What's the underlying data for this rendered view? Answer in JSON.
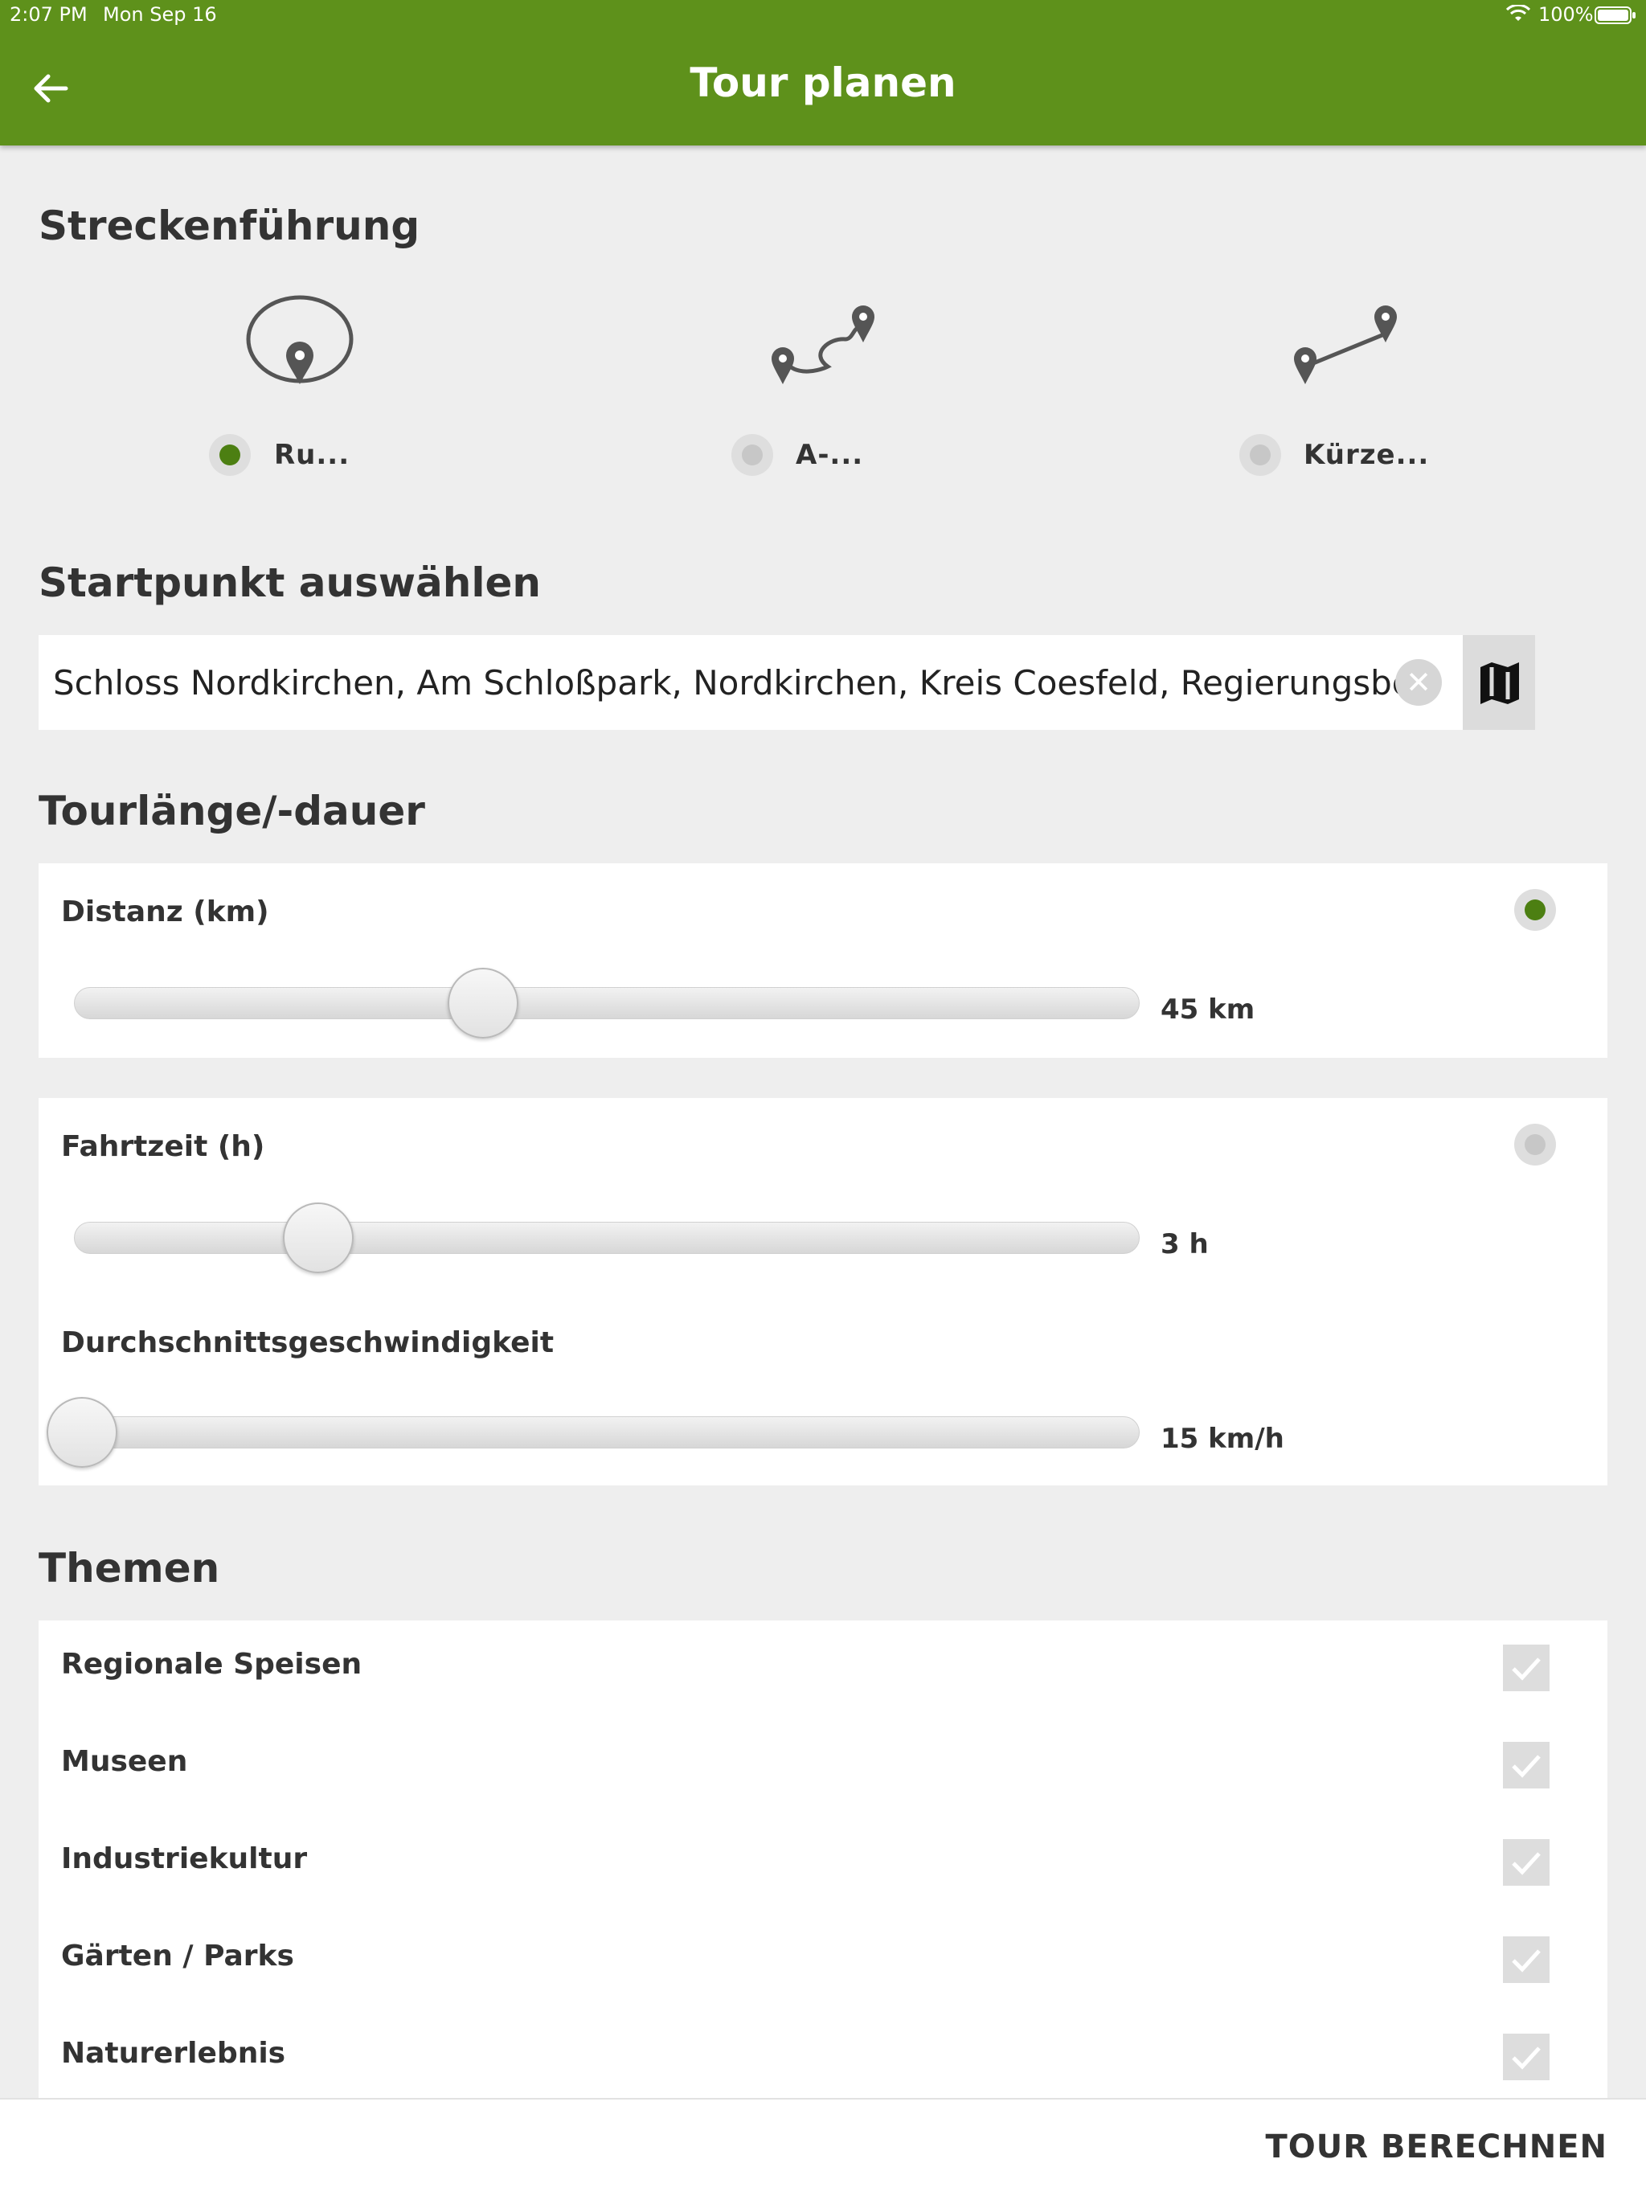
{
  "status_bar": {
    "time": "2:07 PM",
    "date": "Mon Sep 16",
    "battery": "100%"
  },
  "header": {
    "title": "Tour planen",
    "back_icon": "arrow-left-icon",
    "color": "#5e911b"
  },
  "route_section": {
    "title": "Streckenführung",
    "options": [
      {
        "label": "Ru...",
        "icon": "round-trip-icon",
        "selected": true
      },
      {
        "label": "A-...",
        "icon": "a-to-b-route-icon",
        "selected": false
      },
      {
        "label": "Kürze...",
        "icon": "shortest-route-icon",
        "selected": false
      }
    ]
  },
  "start_section": {
    "title": "Startpunkt auswählen",
    "value": "Schloss Nordkirchen, Am Schloßpark, Nordkirchen, Kreis Coesfeld, Regierungsbez",
    "clear_icon": "clear-icon",
    "map_icon": "map-icon"
  },
  "duration_section": {
    "title": "Tourlänge/-dauer",
    "distance": {
      "label": "Distanz (km)",
      "value_text": "45 km",
      "selected": true,
      "level": 0.39
    },
    "time": {
      "label": "Fahrtzeit (h)",
      "value_text": "3 h",
      "selected": false,
      "level": 0.23
    },
    "speed": {
      "label": "Durchschnittsgeschwindigkeit",
      "value_text": "15 km/h",
      "level": 0.0
    },
    "accent": "#4c7f12"
  },
  "themes_section": {
    "title": "Themen",
    "items": [
      {
        "label": "Regionale Speisen",
        "checked": true
      },
      {
        "label": "Museen",
        "checked": true
      },
      {
        "label": "Industriekultur",
        "checked": true
      },
      {
        "label": "Gärten / Parks",
        "checked": true
      },
      {
        "label": "Naturerlebnis",
        "checked": true
      }
    ]
  },
  "footer": {
    "button_label": "TOUR BERECHNEN"
  }
}
